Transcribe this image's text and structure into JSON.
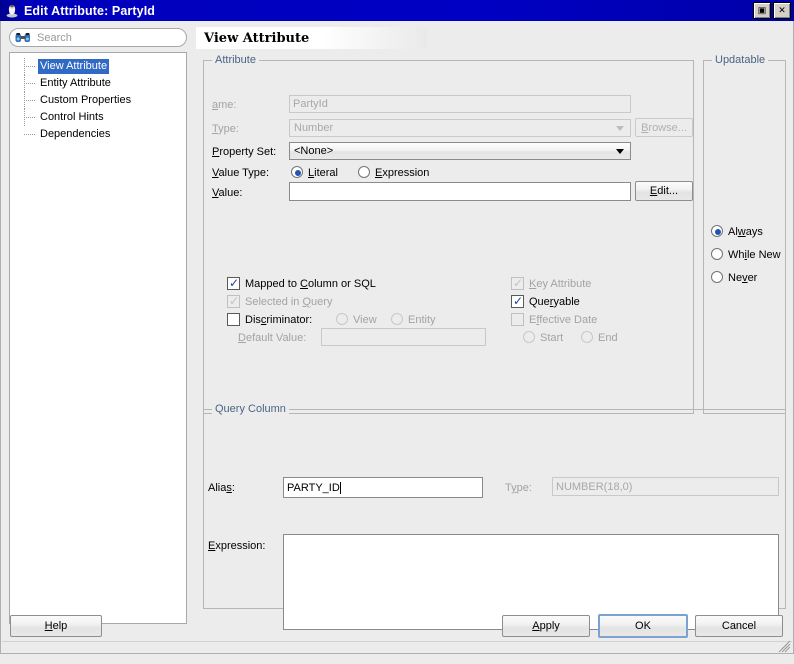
{
  "window": {
    "title": "Edit Attribute: PartyId",
    "icon": "duke-app-icon",
    "buttons": [
      {
        "name": "maximize-button",
        "glyph": "▣"
      },
      {
        "name": "close-button",
        "glyph": "✕"
      }
    ]
  },
  "sidebar": {
    "search": {
      "placeholder": "Search",
      "value": "",
      "icon": "binoculars-icon"
    },
    "items": [
      {
        "label": "View Attribute",
        "selected": true
      },
      {
        "label": "Entity Attribute",
        "selected": false
      },
      {
        "label": "Custom Properties",
        "selected": false
      },
      {
        "label": "Control Hints",
        "selected": false
      },
      {
        "label": "Dependencies",
        "selected": false
      }
    ]
  },
  "page": {
    "heading": "View Attribute"
  },
  "attribute_group": {
    "title": "Attribute",
    "name": {
      "label_pre": "N",
      "label_mn": "a",
      "label_post": "me:",
      "value": "PartyId",
      "disabled": true
    },
    "type": {
      "label_pre": "",
      "label_mn": "T",
      "label_post": "ype:",
      "value": "Number",
      "disabled": true
    },
    "browse_button": {
      "label_pre": "",
      "label_mn": "B",
      "label_post": "rowse...",
      "disabled": true
    },
    "property_set": {
      "label_pre": "",
      "label_mn": "P",
      "label_post": "roperty Set:",
      "value": "<None>"
    },
    "value_type": {
      "label_pre": "",
      "label_mn": "V",
      "label_post": "alue Type:",
      "options": [
        {
          "label_pre": "",
          "label_mn": "L",
          "label_post": "iteral",
          "selected": true
        },
        {
          "label_pre": "",
          "label_mn": "E",
          "label_post": "xpression",
          "selected": false
        }
      ]
    },
    "value": {
      "label_pre": "",
      "label_mn": "V",
      "label_post": "alue:",
      "value": ""
    },
    "edit_button": {
      "label_pre": "",
      "label_mn": "E",
      "label_post": "dit...",
      "disabled": false
    },
    "checks_left": [
      {
        "label_pre": "Mapped to ",
        "label_mn": "C",
        "label_post": "olumn or SQL",
        "checked": true,
        "disabled": false
      },
      {
        "label_pre": "Selected in ",
        "label_mn": "Q",
        "label_post": "uery",
        "checked": true,
        "disabled": true
      },
      {
        "label_pre": "Dis",
        "label_mn": "c",
        "label_post": "riminator:",
        "checked": false,
        "disabled": false
      }
    ],
    "discriminator_radios": [
      {
        "label": "View",
        "selected": false,
        "disabled": true
      },
      {
        "label": "Entity",
        "selected": false,
        "disabled": true
      }
    ],
    "default_value": {
      "label_pre": "",
      "label_mn": "D",
      "label_post": "efault Value:",
      "value": "",
      "disabled": true
    },
    "checks_right": [
      {
        "label_pre": "",
        "label_mn": "K",
        "label_post": "ey Attribute",
        "checked": true,
        "disabled": true
      },
      {
        "label_pre": "Que",
        "label_mn": "r",
        "label_post": "yable",
        "checked": true,
        "disabled": false
      },
      {
        "label_pre": "E",
        "label_mn": "f",
        "label_post": "fective Date",
        "checked": false,
        "disabled": true
      }
    ],
    "effective_radios": [
      {
        "label": "Start",
        "selected": false,
        "disabled": true
      },
      {
        "label": "End",
        "selected": false,
        "disabled": true
      }
    ]
  },
  "updatable_group": {
    "title": "Updatable",
    "options": [
      {
        "label_pre": "Al",
        "label_mn": "w",
        "label_post": "ays",
        "selected": true
      },
      {
        "label_pre": "Wh",
        "label_mn": "i",
        "label_post": "le New",
        "selected": false
      },
      {
        "label_pre": "Ne",
        "label_mn": "v",
        "label_post": "er",
        "selected": false
      }
    ]
  },
  "query_column_group": {
    "title": "Query Column",
    "alias": {
      "label_pre": "Alia",
      "label_mn": "s",
      "label_post": ":",
      "value": "PARTY_ID",
      "focused": true
    },
    "type": {
      "label_pre": "T",
      "label_mn": "y",
      "label_post": "pe:",
      "value": "NUMBER(18,0)",
      "disabled": true
    },
    "expression": {
      "label_pre": "",
      "label_mn": "E",
      "label_post": "xpression:",
      "value": ""
    }
  },
  "footer": {
    "help": {
      "label_pre": "",
      "label_mn": "H",
      "label_post": "elp"
    },
    "apply": {
      "label_pre": "",
      "label_mn": "A",
      "label_post": "pply"
    },
    "ok": {
      "label": "OK",
      "focused": true
    },
    "cancel": {
      "label": "Cancel"
    }
  }
}
